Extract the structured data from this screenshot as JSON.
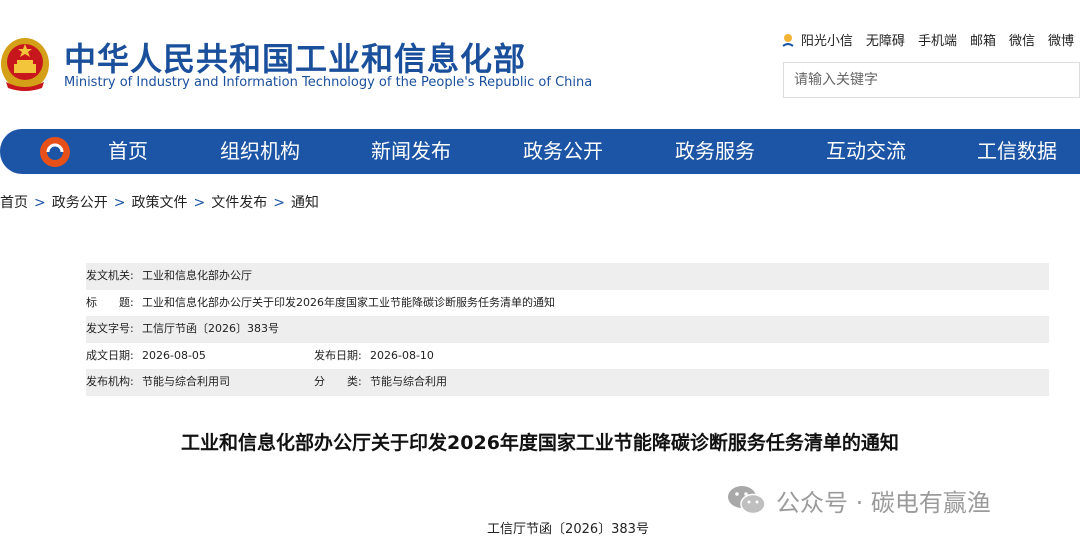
{
  "header": {
    "title_cn": "中华人民共和国工业和信息化部",
    "title_en": "Ministry of Industry and Information Technology of the People's Republic of China",
    "top_links": [
      "阳光小信",
      "无障碍",
      "手机端",
      "邮箱",
      "微信",
      "微博"
    ],
    "search_placeholder": "请输入关键字"
  },
  "nav": {
    "items": [
      "首页",
      "组织机构",
      "新闻发布",
      "政务公开",
      "政务服务",
      "互动交流",
      "工信数据"
    ]
  },
  "breadcrumb": {
    "items": [
      "首页",
      "政务公开",
      "政策文件",
      "文件发布",
      "通知"
    ],
    "separator": ">"
  },
  "info": {
    "issuer_label": "发文机关:",
    "issuer": "工业和信息化部办公厅",
    "title_label": "标　　题:",
    "title": "工业和信息化部办公厅关于印发2026年度国家工业节能降碳诊断服务任务清单的通知",
    "doc_no_label": "发文字号:",
    "doc_no": "工信厅节函〔2026〕383号",
    "created_label": "成文日期:",
    "created": "2026-08-05",
    "published_label": "发布日期:",
    "published": "2026-08-10",
    "org_label": "发布机构:",
    "org": "节能与综合利用司",
    "category_label": "分　　类:",
    "category": "节能与综合利用"
  },
  "document": {
    "title": "工业和信息化部办公厅关于印发2026年度国家工业节能降碳诊断服务任务清单的通知",
    "number": "工信厅节函〔2026〕383号"
  },
  "watermark": {
    "text": "公众号 · 碳电有赢渔"
  },
  "colors": {
    "brand_blue": "#1c55a5",
    "title_blue": "#1a4f9c",
    "row_shade": "#eeeeee"
  }
}
